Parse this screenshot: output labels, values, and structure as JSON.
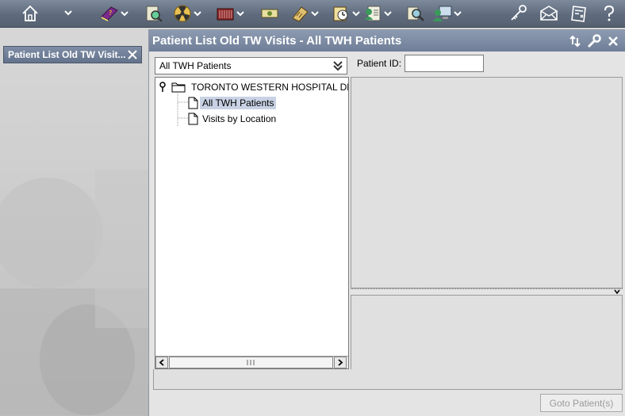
{
  "toolbar": {
    "icons": [
      {
        "name": "home-icon",
        "dropdown": true
      },
      {
        "name": "help-book-icon",
        "dropdown": true
      },
      {
        "name": "patient-search-icon",
        "dropdown": false
      },
      {
        "name": "nuclear-icon",
        "dropdown": true
      },
      {
        "name": "building-icon",
        "dropdown": true
      },
      {
        "name": "money-icon",
        "dropdown": false
      },
      {
        "name": "calculator-icon",
        "dropdown": true
      },
      {
        "name": "clock-icon",
        "dropdown": true
      },
      {
        "name": "user-document-icon",
        "dropdown": true
      },
      {
        "name": "magnifier-icon",
        "dropdown": false
      },
      {
        "name": "computer-user-icon",
        "dropdown": true
      },
      {
        "name": "key-icon",
        "dropdown": false
      },
      {
        "name": "mail-icon",
        "dropdown": false
      },
      {
        "name": "notes-icon",
        "dropdown": false
      },
      {
        "name": "help-icon",
        "dropdown": false
      }
    ]
  },
  "left_tab": {
    "label": "Patient List Old TW Visit..."
  },
  "window": {
    "title": "Patient List Old TW Visits - All TWH Patients",
    "controls": [
      "refresh-icon",
      "wrench-icon",
      "close-icon"
    ],
    "list_select": {
      "value": "All TWH Patients"
    },
    "tree": {
      "root": "TORONTO WESTERN HOSPITAL DE",
      "children": [
        {
          "label": "All TWH Patients",
          "selected": true
        },
        {
          "label": "Visits by Location",
          "selected": false
        }
      ]
    },
    "patient_id": {
      "label": "Patient ID:",
      "value": ""
    },
    "goto_button": "Goto Patient(s)"
  },
  "colors": {
    "toolbar_bg": "#5f6b7d",
    "title_bar": "#7d8ca5",
    "selection": "#c8d2e4",
    "disabled_text": "#9b9b9b"
  }
}
